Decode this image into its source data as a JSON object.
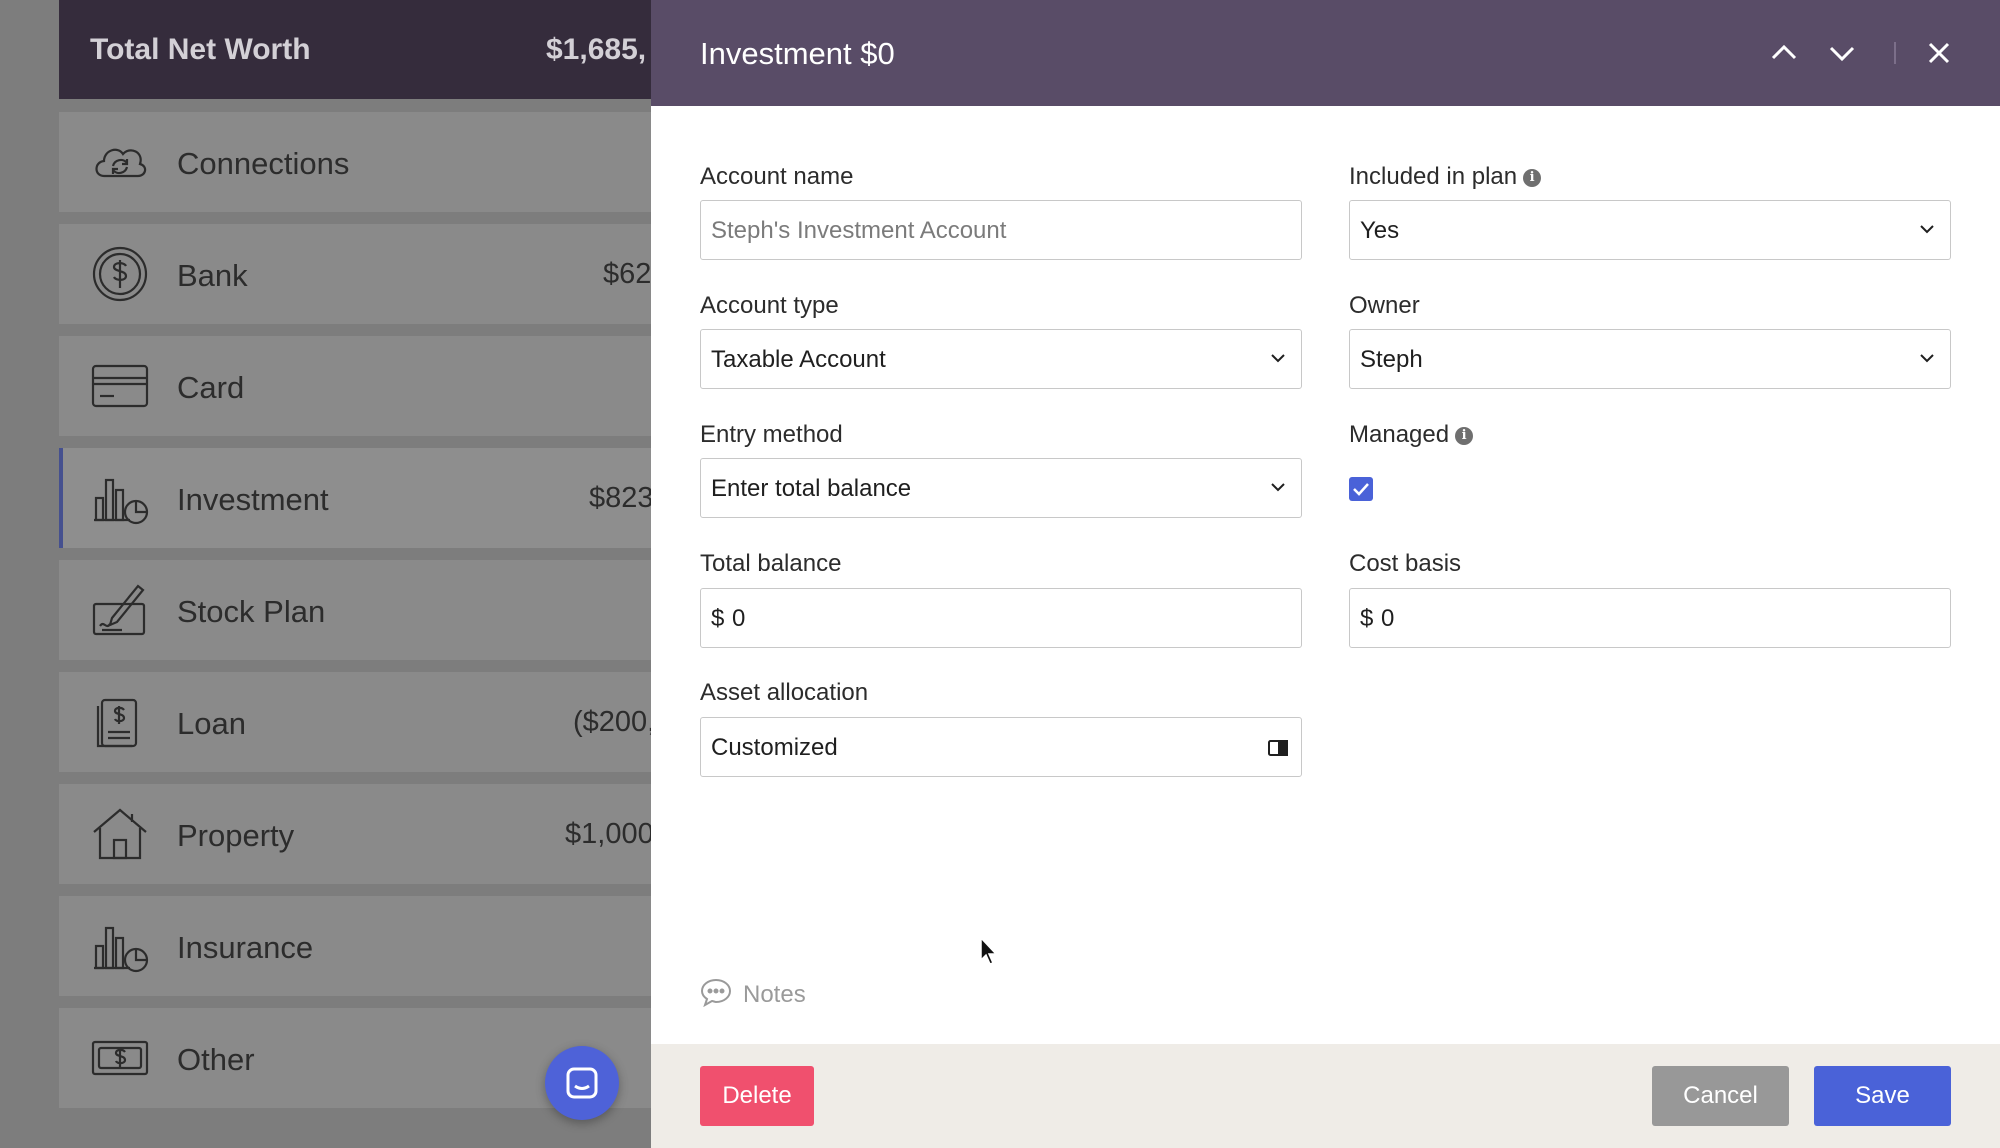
{
  "sidebar": {
    "net_worth": {
      "title": "Total Net Worth",
      "value": "$1,685,"
    },
    "items": [
      {
        "label": "Connections",
        "amount": "",
        "icon": "cloud-sync-icon"
      },
      {
        "label": "Bank",
        "amount": "$62",
        "icon": "dollar-coin-icon"
      },
      {
        "label": "Card",
        "amount": "",
        "icon": "credit-card-icon"
      },
      {
        "label": "Investment",
        "amount": "$823",
        "icon": "investment-chart-icon",
        "active": true
      },
      {
        "label": "Stock Plan",
        "amount": "",
        "icon": "signature-icon"
      },
      {
        "label": "Loan",
        "amount": "($200,",
        "icon": "loan-document-icon"
      },
      {
        "label": "Property",
        "amount": "$1,000",
        "icon": "house-icon"
      },
      {
        "label": "Insurance",
        "amount": "",
        "icon": "insurance-chart-icon"
      },
      {
        "label": "Other",
        "amount": "",
        "icon": "banknote-icon"
      }
    ]
  },
  "panel": {
    "title": "Investment $0",
    "fields": {
      "account_name": {
        "label": "Account name",
        "placeholder": "Steph's Investment Account"
      },
      "included_in_plan": {
        "label": "Included in plan",
        "value": "Yes"
      },
      "account_type": {
        "label": "Account type",
        "value": "Taxable Account"
      },
      "owner": {
        "label": "Owner",
        "value": "Steph"
      },
      "entry_method": {
        "label": "Entry method",
        "value": "Enter total balance"
      },
      "managed": {
        "label": "Managed",
        "checked": true
      },
      "total_balance": {
        "label": "Total balance",
        "currency": "$",
        "value": "0"
      },
      "cost_basis": {
        "label": "Cost basis",
        "currency": "$",
        "value": "0"
      },
      "asset_allocation": {
        "label": "Asset allocation",
        "value": "Customized"
      }
    },
    "notes_label": "Notes",
    "buttons": {
      "delete": "Delete",
      "cancel": "Cancel",
      "save": "Save"
    }
  },
  "colors": {
    "header": "#594c67",
    "accent": "#4a62d8",
    "delete": "#f0506e",
    "cancel": "#989898"
  }
}
